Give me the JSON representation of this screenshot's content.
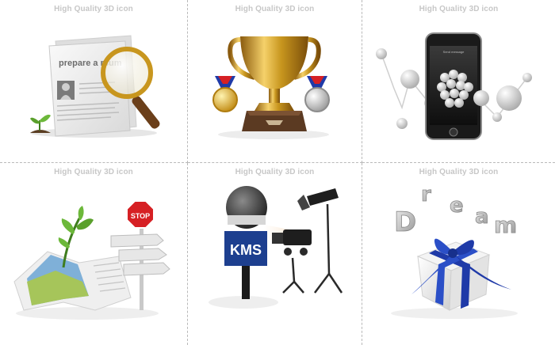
{
  "captions": [
    "High Quality 3D icon",
    "High Quality 3D icon",
    "High Quality 3D icon",
    "High Quality 3D icon",
    "High Quality 3D icon",
    "High Quality 3D icon"
  ],
  "icons": {
    "resume": {
      "name": "resume-magnifier-icon",
      "text": "prepare a rsum"
    },
    "trophy": {
      "name": "trophy-medals-icon"
    },
    "phone": {
      "name": "smartphone-molecule-icon",
      "status_text": "Send message"
    },
    "map": {
      "name": "map-signpost-icon",
      "stop_text": "STOP"
    },
    "mic": {
      "name": "microphone-studio-lights-icon",
      "mic_text": "KMS"
    },
    "gift": {
      "name": "dream-gift-box-icon",
      "letters": [
        "D",
        "r",
        "e",
        "a",
        "m"
      ]
    }
  },
  "colors": {
    "caption": "#c7c7c7",
    "divider": "#b9b9b9",
    "gold": "#c8961e",
    "ribbon_blue": "#1f3aa8",
    "stop_red": "#d62024",
    "kms_blue": "#1d3f8f"
  }
}
